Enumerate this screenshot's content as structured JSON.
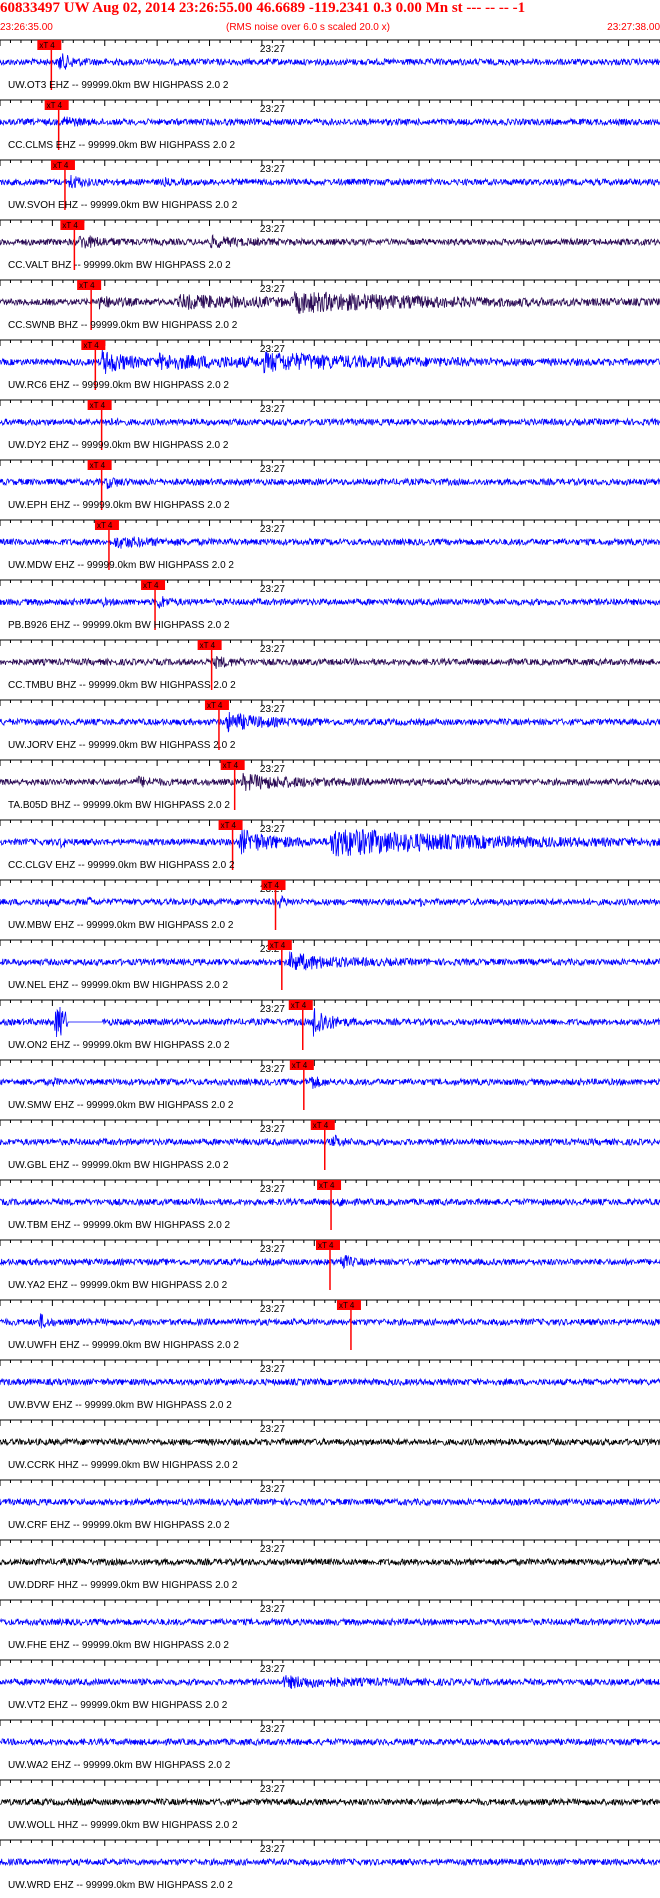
{
  "header": {
    "title": "60833497 UW Aug 02, 2014 23:26:55.00   46.6689 -119.2341  0.3 0.00 Mn st --- -- --   -1",
    "start_time": "23:26:35.00",
    "note": "(RMS noise over 6.0 s scaled 20.0 x)",
    "end_time": "23:27:38.00"
  },
  "chart_data": {
    "type": "line",
    "title": "60833497 UW Aug 02, 2014 23:26:55.00   46.6689 -119.2341  0.3 0.00 Mn st --- -- --   -1",
    "x_start": "23:26:35.00",
    "x_end": "23:27:38.00",
    "x_range_seconds": [
      0,
      63
    ],
    "minute_mark": "23:27",
    "pick_label": "xT 4",
    "colors": {
      "pick": "#ff0000",
      "blue_trace": "#0000ff",
      "purple_trace": "#2a0a55",
      "black_trace": "#000000",
      "text": "#ff0000"
    },
    "traces": [
      {
        "label": "UW.OT3 EHZ -- 99999.0km BW  HIGHPASS  2.0  2",
        "pick_s": 4.9,
        "color": "blue",
        "events": [
          [
            5.5,
            2.6,
            1.2
          ]
        ]
      },
      {
        "label": "CC.CLMS EHZ -- 99999.0km BW  HIGHPASS  2.0  2",
        "pick_s": 5.6,
        "color": "blue",
        "events": [
          [
            6.0,
            1.8,
            0.9
          ]
        ]
      },
      {
        "label": "UW.SVOH EHZ -- 99999.0km BW  HIGHPASS  2.0  2",
        "pick_s": 6.2,
        "color": "blue",
        "events": [
          [
            6.5,
            2.2,
            1.0
          ],
          [
            15.6,
            1.0,
            0.1
          ]
        ]
      },
      {
        "label": "CC.VALT BHZ -- 99999.0km BW  HIGHPASS  2.0  2",
        "pick_s": 7.1,
        "color": "purple",
        "events": [
          [
            7.5,
            1.8,
            2.0
          ],
          [
            20.0,
            1.3,
            2.5
          ]
        ]
      },
      {
        "label": "CC.SWNB BHZ -- 99999.0km BW  HIGHPASS  2.0  2",
        "pick_s": 8.7,
        "color": "purple",
        "events": [
          [
            9.2,
            1.5,
            2.0
          ],
          [
            17.0,
            1.6,
            10.0
          ],
          [
            28.0,
            2.3,
            12.0
          ]
        ]
      },
      {
        "label": "UW.RC6 EHZ -- 99999.0km BW  HIGHPASS  2.0  2",
        "pick_s": 9.1,
        "color": "blue",
        "events": [
          [
            9.6,
            3.5,
            2.5
          ],
          [
            15.0,
            1.5,
            13.0
          ],
          [
            25.0,
            1.8,
            10.0
          ]
        ]
      },
      {
        "label": "UW.DY2 EHZ -- 99999.0km BW  HIGHPASS  2.0  2",
        "pick_s": 9.7,
        "color": "blue",
        "events": [
          [
            10.0,
            1.2,
            0.5
          ]
        ]
      },
      {
        "label": "UW.EPH EHZ -- 99999.0km BW  HIGHPASS  2.0  2",
        "pick_s": 9.7,
        "color": "blue",
        "events": [
          [
            10.0,
            1.6,
            1.0
          ]
        ]
      },
      {
        "label": "UW.MDW EHZ -- 99999.0km BW  HIGHPASS  2.0  2",
        "pick_s": 10.4,
        "color": "blue",
        "events": [
          [
            10.9,
            1.4,
            3.0
          ]
        ]
      },
      {
        "label": "PB.B926 EHZ -- 99999.0km BW  HIGHPASS  2.0  2",
        "pick_s": 14.8,
        "color": "blue",
        "events": [
          [
            15.0,
            2.0,
            0.8
          ],
          [
            9.7,
            0.9,
            0.1
          ],
          [
            58.5,
            1.1,
            0.1
          ]
        ]
      },
      {
        "label": "CC.TMBU BHZ -- 99999.0km BW  HIGHPASS  2.0  2",
        "pick_s": 20.2,
        "color": "purple",
        "events": [
          [
            20.4,
            1.4,
            1.5
          ]
        ]
      },
      {
        "label": "UW.JORV EHZ -- 99999.0km BW  HIGHPASS  2.0  2",
        "pick_s": 20.9,
        "color": "blue",
        "events": [
          [
            21.5,
            2.6,
            3.0
          ]
        ]
      },
      {
        "label": "TA.B05D BHZ -- 99999.0km BW  HIGHPASS  2.0  2",
        "pick_s": 22.4,
        "color": "purple",
        "events": [
          [
            13.0,
            1.2,
            1.5
          ],
          [
            23.0,
            2.0,
            5.0
          ]
        ]
      },
      {
        "label": "CC.CLGV EHZ -- 99999.0km BW  HIGHPASS  2.0  2",
        "pick_s": 22.2,
        "color": "blue",
        "events": [
          [
            5.7,
            2.0,
            0.4
          ],
          [
            22.8,
            3.5,
            3.0
          ],
          [
            31.5,
            4.0,
            12.0
          ]
        ]
      },
      {
        "label": "UW.MBW EHZ -- 99999.0km BW  HIGHPASS  2.0  2",
        "pick_s": 26.3,
        "color": "blue",
        "events": [
          [
            8.3,
            2.0,
            0.3
          ],
          [
            26.6,
            1.8,
            0.5
          ],
          [
            4.4,
            0.8,
            0.1
          ],
          [
            40.0,
            0.9,
            0.1
          ]
        ]
      },
      {
        "label": "UW.NEL EHZ -- 99999.0km BW  HIGHPASS  2.0  2",
        "pick_s": 26.9,
        "color": "blue",
        "events": [
          [
            27.5,
            2.4,
            4.0
          ]
        ]
      },
      {
        "label": "UW.ON2 EHZ -- 99999.0km BW  HIGHPASS  2.0  2",
        "pick_s": 28.9,
        "color": "blue",
        "events": [
          [
            5.2,
            6.0,
            1.2
          ],
          [
            29.8,
            6.0,
            1.2
          ]
        ],
        "gap": [
          6.5,
          9.8
        ]
      },
      {
        "label": "UW.SMW EHZ -- 99999.0km BW  HIGHPASS  2.0  2",
        "pick_s": 29.0,
        "color": "blue",
        "events": [
          [
            29.5,
            3.0,
            0.6
          ],
          [
            4.9,
            1.6,
            0.2
          ]
        ]
      },
      {
        "label": "UW.GBL EHZ -- 99999.0km BW  HIGHPASS  2.0  2",
        "pick_s": 31.0,
        "color": "blue",
        "events": [
          [
            31.7,
            1.8,
            0.8
          ]
        ]
      },
      {
        "label": "UW.TBM EHZ -- 99999.0km BW  HIGHPASS  2.0  2",
        "pick_s": 31.6,
        "color": "blue",
        "events": [
          [
            32.3,
            1.2,
            0.5
          ]
        ]
      },
      {
        "label": "UW.YA2 EHZ -- 99999.0km BW  HIGHPASS  2.0  2",
        "pick_s": 31.5,
        "color": "blue",
        "events": [
          [
            32.4,
            2.6,
            0.8
          ]
        ]
      },
      {
        "label": "UW.UWFH EHZ -- 99999.0km BW  HIGHPASS  2.0  2",
        "pick_s": 33.5,
        "color": "blue",
        "events": [
          [
            3.7,
            2.5,
            0.6
          ]
        ]
      },
      {
        "label": "UW.BVW EHZ -- 99999.0km BW  HIGHPASS  2.0  2",
        "pick_s": null,
        "color": "blue",
        "events": []
      },
      {
        "label": "UW.CCRK HHZ -- 99999.0km BW  HIGHPASS  2.0  2",
        "pick_s": null,
        "color": "black",
        "events": []
      },
      {
        "label": "UW.CRF EHZ -- 99999.0km BW  HIGHPASS  2.0  2",
        "pick_s": null,
        "color": "blue",
        "events": []
      },
      {
        "label": "UW.DDRF HHZ -- 99999.0km BW  HIGHPASS  2.0  2",
        "pick_s": null,
        "color": "black",
        "events": []
      },
      {
        "label": "UW.FHE EHZ -- 99999.0km BW  HIGHPASS  2.0  2",
        "pick_s": null,
        "color": "blue",
        "events": []
      },
      {
        "label": "UW.VT2 EHZ -- 99999.0km BW  HIGHPASS  2.0  2",
        "pick_s": null,
        "color": "blue",
        "events": [
          [
            27.0,
            1.3,
            6.0
          ]
        ]
      },
      {
        "label": "UW.WA2 EHZ -- 99999.0km BW  HIGHPASS  2.0  2",
        "pick_s": null,
        "color": "blue",
        "events": []
      },
      {
        "label": "UW.WOLL HHZ -- 99999.0km BW  HIGHPASS  2.0  2",
        "pick_s": null,
        "color": "black",
        "events": []
      },
      {
        "label": "UW.WRD EHZ -- 99999.0km BW  HIGHPASS  2.0  2",
        "pick_s": null,
        "color": "blue",
        "events": []
      }
    ]
  }
}
